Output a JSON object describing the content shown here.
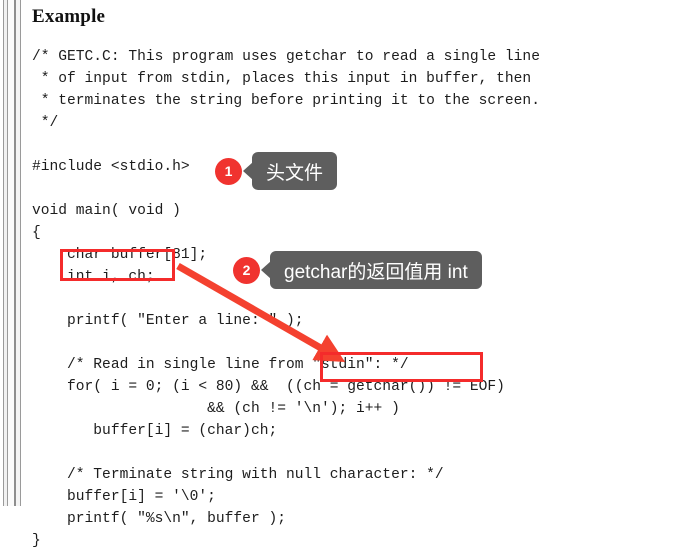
{
  "page": {
    "title": "Example",
    "background_color": "#ffffff",
    "text_color": "#1d1d1d"
  },
  "code": {
    "language": "c",
    "lines": [
      "/* GETC.C: This program uses getchar to read a single line",
      " * of input from stdin, places this input in buffer, then",
      " * terminates the string before printing it to the screen.",
      " */",
      "",
      "#include <stdio.h>",
      "",
      "void main( void )",
      "{",
      "    char buffer[81];",
      "    int i, ch;",
      "",
      "    printf( \"Enter a line: \" );",
      "",
      "    /* Read in single line from \"stdin\": */",
      "    for( i = 0; (i < 80) &&  ((ch = getchar()) != EOF)",
      "                    && (ch != '\\n'); i++ )",
      "       buffer[i] = (char)ch;",
      "",
      "    /* Terminate string with null character: */",
      "    buffer[i] = '\\0';",
      "    printf( \"%s\\n\", buffer );",
      "}"
    ]
  },
  "annotations": {
    "accent_color": "#f42b2b",
    "badge_color": "#f0332f",
    "bubble_color": "#5e5e5e",
    "callouts": [
      {
        "number": "1",
        "text": "头文件",
        "target_code": "#include <stdio.h>"
      },
      {
        "number": "2",
        "text": "getchar的返回值用 int",
        "target_code": "int i, ch;"
      }
    ],
    "highlight_boxes": [
      {
        "id": "1",
        "code": "int i, ch;"
      },
      {
        "id": "2",
        "code": "((ch = getchar())"
      }
    ],
    "arrow": {
      "from_label": "int i, ch;",
      "to_label": "((ch = getchar())"
    }
  }
}
